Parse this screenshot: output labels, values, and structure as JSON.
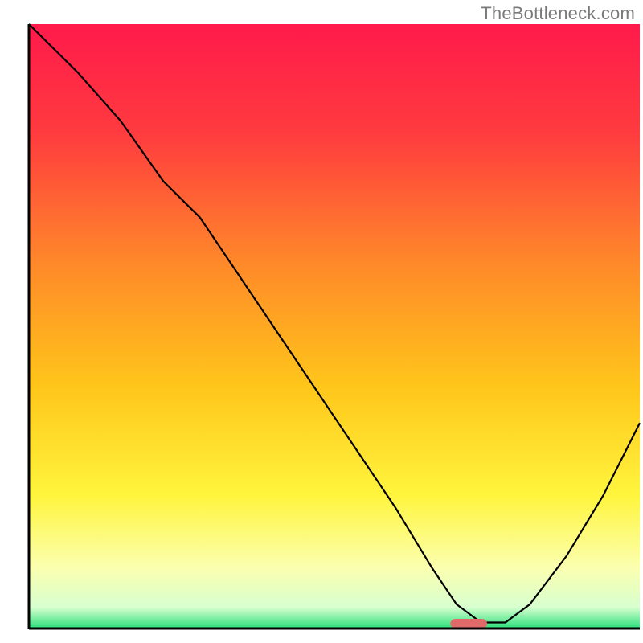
{
  "watermark": "TheBottleneck.com",
  "chart_data": {
    "type": "line",
    "title": "",
    "xlabel": "",
    "ylabel": "",
    "xlim": [
      0,
      100
    ],
    "ylim": [
      0,
      100
    ],
    "grid": false,
    "legend": false,
    "gradient_background": {
      "stops": [
        {
          "offset": 0.0,
          "color": "#ff1a4b"
        },
        {
          "offset": 0.18,
          "color": "#ff3b3f"
        },
        {
          "offset": 0.4,
          "color": "#ff8a29"
        },
        {
          "offset": 0.6,
          "color": "#ffc61a"
        },
        {
          "offset": 0.78,
          "color": "#fff53d"
        },
        {
          "offset": 0.9,
          "color": "#fbffb0"
        },
        {
          "offset": 0.965,
          "color": "#d7ffcf"
        },
        {
          "offset": 1.0,
          "color": "#29e07a"
        }
      ]
    },
    "series": [
      {
        "name": "bottleneck-curve",
        "color": "#000000",
        "x": [
          0,
          8,
          15,
          22,
          28,
          36,
          44,
          52,
          60,
          66,
          70,
          74,
          78,
          82,
          88,
          94,
          100
        ],
        "y": [
          100,
          92,
          84,
          74,
          68,
          56,
          44,
          32,
          20,
          10,
          4,
          1,
          1,
          4,
          12,
          22,
          34
        ]
      }
    ],
    "marker": {
      "name": "optimal-point",
      "x": 72,
      "y": 0.8,
      "color": "#e06a6a",
      "width": 6,
      "height": 1.6
    },
    "annotations": []
  }
}
